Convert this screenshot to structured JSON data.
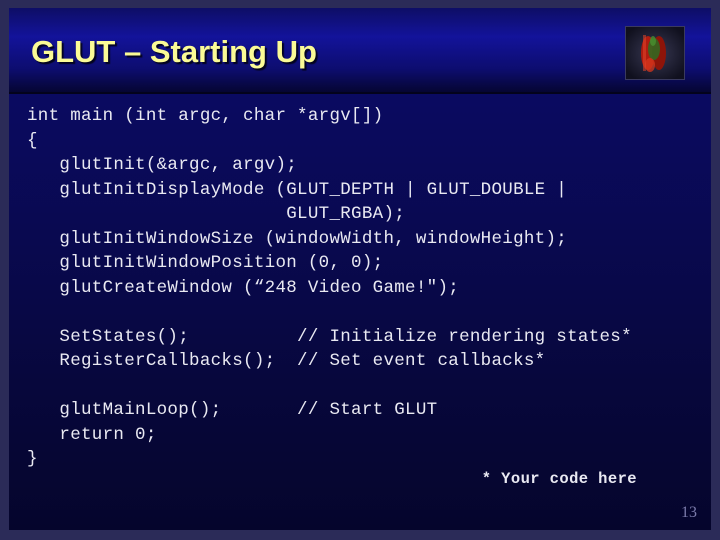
{
  "slide": {
    "title": "GLUT – Starting Up",
    "page_number": "13",
    "footnote": "* Your code here",
    "logo_name": "volume-rendering-thumbnail",
    "colors": {
      "title_text": "#fbfb96",
      "code_text": "#e9e9f2",
      "page_number": "#7b7bab",
      "header_blue": "#13139a",
      "body_blue_top": "#0b0b6d",
      "body_blue_bottom": "#05052c",
      "frame_border": "#2b2b58"
    }
  },
  "code": {
    "lines": [
      "int main (int argc, char *argv[])",
      "{",
      "   glutInit(&argc, argv);",
      "   glutInitDisplayMode (GLUT_DEPTH | GLUT_DOUBLE |",
      "                        GLUT_RGBA);",
      "   glutInitWindowSize (windowWidth, windowHeight);",
      "   glutInitWindowPosition (0, 0);",
      "   glutCreateWindow (“248 Video Game!\");",
      "",
      "   SetStates();          // Initialize rendering states*",
      "   RegisterCallbacks();  // Set event callbacks*",
      "",
      "   glutMainLoop();       // Start GLUT",
      "   return 0;",
      "}"
    ]
  }
}
